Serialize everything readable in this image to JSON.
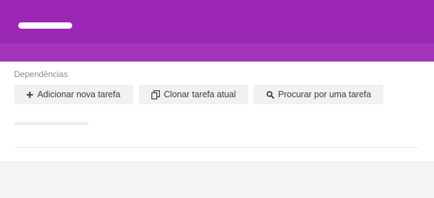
{
  "header": {
    "brand_color": "#9d27b5"
  },
  "dependencies": {
    "label": "Dependências",
    "buttons": {
      "add": {
        "label": "Adicionar nova tarefa",
        "icon": "plus-icon"
      },
      "clone": {
        "label": "Clonar tarefa atual",
        "icon": "copy-icon"
      },
      "search": {
        "label": "Procurar por uma tarefa",
        "icon": "search-icon"
      }
    }
  }
}
